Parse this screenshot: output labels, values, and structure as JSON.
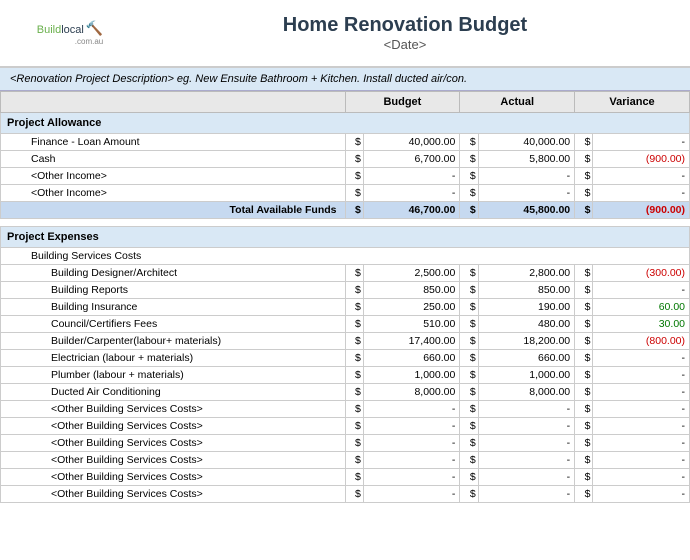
{
  "header": {
    "logo_build": "Build",
    "logo_local": "local",
    "logo_dot_com": ".com.au",
    "main_title": "Home Renovation Budget",
    "date_label": "<Date>"
  },
  "description": "<Renovation Project Description> eg. New Ensuite Bathroom + Kitchen. Install ducted air/con.",
  "columns": {
    "budget": "Budget",
    "actual": "Actual",
    "variance": "Variance"
  },
  "project_allowance": {
    "section_label": "Project Allowance",
    "rows": [
      {
        "label": "Finance - Loan Amount",
        "budget": "40,000.00",
        "actual": "40,000.00",
        "variance": "-",
        "var_neg": false
      },
      {
        "label": "Cash",
        "budget": "6,700.00",
        "actual": "5,800.00",
        "variance": "(900.00)",
        "var_neg": true
      },
      {
        "label": "<Other Income>",
        "budget": "-",
        "actual": "-",
        "variance": "-",
        "var_neg": false
      },
      {
        "label": "<Other Income>",
        "budget": "-",
        "actual": "-",
        "variance": "-",
        "var_neg": false
      }
    ],
    "total_label": "Total Available Funds",
    "total_budget": "46,700.00",
    "total_actual": "45,800.00",
    "total_variance": "(900.00)"
  },
  "project_expenses": {
    "section_label": "Project Expenses",
    "subsection_label": "Building Services Costs",
    "rows": [
      {
        "label": "Building Designer/Architect",
        "budget": "2,500.00",
        "actual": "2,800.00",
        "variance": "(300.00)",
        "var_neg": true
      },
      {
        "label": "Building Reports",
        "budget": "850.00",
        "actual": "850.00",
        "variance": "-",
        "var_neg": false
      },
      {
        "label": "Building Insurance",
        "budget": "250.00",
        "actual": "190.00",
        "variance": "60.00",
        "var_neg": false
      },
      {
        "label": "Council/Certifiers Fees",
        "budget": "510.00",
        "actual": "480.00",
        "variance": "30.00",
        "var_neg": false
      },
      {
        "label": "Builder/Carpenter(labour+ materials)",
        "budget": "17,400.00",
        "actual": "18,200.00",
        "variance": "(800.00)",
        "var_neg": true
      },
      {
        "label": "Electrician (labour + materials)",
        "budget": "660.00",
        "actual": "660.00",
        "variance": "-",
        "var_neg": false
      },
      {
        "label": "Plumber (labour + materials)",
        "budget": "1,000.00",
        "actual": "1,000.00",
        "variance": "-",
        "var_neg": false
      },
      {
        "label": "Ducted Air Conditioning",
        "budget": "8,000.00",
        "actual": "8,000.00",
        "variance": "-",
        "var_neg": false
      },
      {
        "label": "<Other Building Services Costs>",
        "budget": "-",
        "actual": "-",
        "variance": "-",
        "var_neg": false
      },
      {
        "label": "<Other Building Services Costs>",
        "budget": "-",
        "actual": "-",
        "variance": "-",
        "var_neg": false
      },
      {
        "label": "<Other Building Services Costs>",
        "budget": "-",
        "actual": "-",
        "variance": "-",
        "var_neg": false
      },
      {
        "label": "<Other Building Services Costs>",
        "budget": "-",
        "actual": "-",
        "variance": "-",
        "var_neg": false
      },
      {
        "label": "<Other Building Services Costs>",
        "budget": "-",
        "actual": "-",
        "variance": "-",
        "var_neg": false
      },
      {
        "label": "<Other Building Services Costs>",
        "budget": "-",
        "actual": "-",
        "variance": "-",
        "var_neg": false
      }
    ]
  }
}
